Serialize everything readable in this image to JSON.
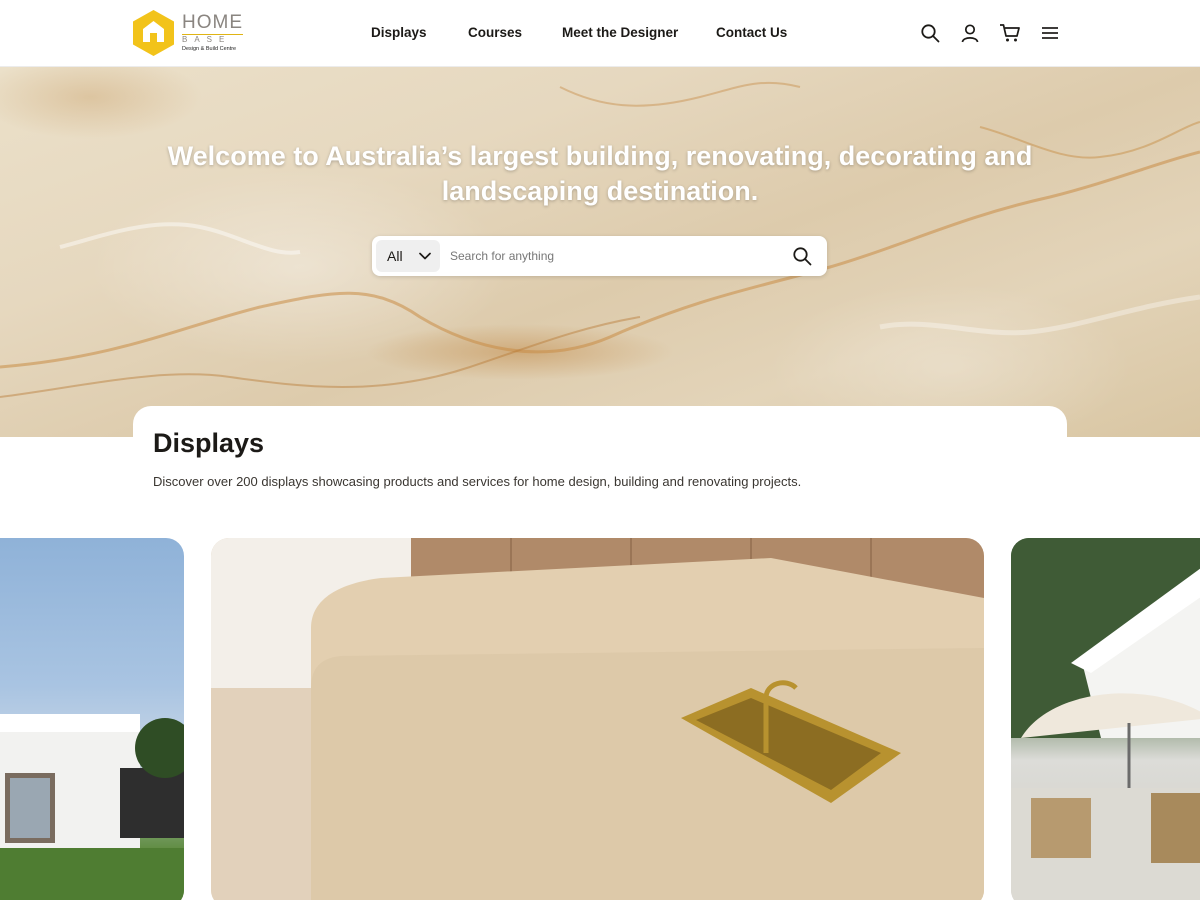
{
  "brand": {
    "name": "HOME",
    "subname": "BASE",
    "tagline": "Design & Build Centre",
    "logo_icon": "house-hexagon-icon",
    "accent_color": "#f2c31a"
  },
  "nav": {
    "items": [
      {
        "label": "Displays"
      },
      {
        "label": "Courses"
      },
      {
        "label": "Meet the Designer"
      },
      {
        "label": "Contact Us"
      }
    ]
  },
  "toolbar": {
    "icons": [
      "search-icon",
      "user-icon",
      "cart-icon",
      "menu-icon"
    ]
  },
  "hero": {
    "title": "Welcome to Australia’s largest building, renovating, decorating and landscaping destination.",
    "search": {
      "category": "All",
      "placeholder": "Search for anything",
      "value": ""
    }
  },
  "displays": {
    "title": "Displays",
    "description": "Discover over 200 displays showcasing products and services for home design, building and renovating projects."
  },
  "carousel": {
    "tiles": [
      {
        "image": "modern-white-house-exterior"
      },
      {
        "image": "travertine-kitchen-island-brass-sink"
      },
      {
        "image": "white-cottage-with-umbrella-patio"
      }
    ]
  }
}
